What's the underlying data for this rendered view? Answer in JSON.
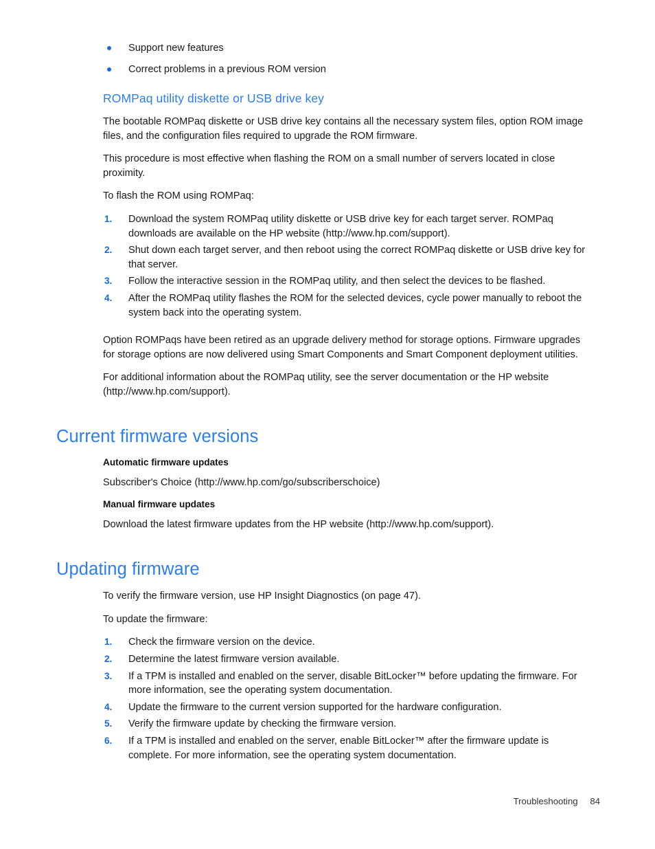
{
  "document": {
    "footer": {
      "chapter": "Troubleshooting",
      "page_number": "84"
    },
    "colors": {
      "heading_blue": "#2a7ef0",
      "marker_blue": "#1668dc",
      "body_text": "#1a1a1a"
    }
  },
  "intro_bullets": [
    "Support new features",
    "Correct problems in a previous ROM version"
  ],
  "rompaq_section": {
    "heading": "ROMPaq utility diskette or USB drive key",
    "paragraph_1": "The bootable ROMPaq diskette or USB drive key contains all the necessary system files, option ROM image files, and the configuration files required to upgrade the ROM firmware.",
    "paragraph_2": "This procedure is most effective when flashing the ROM on a small number of servers located in close proximity.",
    "lead_in": "To flash the ROM using ROMPaq:",
    "steps": [
      {
        "num": "1.",
        "text": "Download the system ROMPaq utility diskette or USB drive key for each target server. ROMPaq downloads are available on the HP website (http://www.hp.com/support)."
      },
      {
        "num": "2.",
        "text": "Shut down each target server, and then reboot using the correct ROMPaq diskette or USB drive key for that server."
      },
      {
        "num": "3.",
        "text": "Follow the interactive session in the ROMPaq utility, and then select the devices to be flashed."
      },
      {
        "num": "4.",
        "text": "After the ROMPaq utility flashes the ROM for the selected devices, cycle power manually to reboot the system back into the operating system."
      }
    ],
    "paragraph_3": "Option ROMPaqs have been retired as an upgrade delivery method for storage options. Firmware upgrades for storage options are now delivered using Smart Components and Smart Component deployment utilities.",
    "paragraph_4": "For additional information about the ROMPaq utility, see the server documentation or the HP website (http://www.hp.com/support)."
  },
  "current_firmware_section": {
    "heading": "Current firmware versions",
    "automatic_heading": "Automatic firmware updates",
    "automatic_text": "Subscriber's Choice (http://www.hp.com/go/subscriberschoice)",
    "manual_heading": "Manual firmware updates",
    "manual_text": "Download the latest firmware updates from the HP website (http://www.hp.com/support)."
  },
  "updating_firmware_section": {
    "heading": "Updating firmware",
    "paragraph_1": "To verify the firmware version, use HP Insight Diagnostics (on page 47).",
    "lead_in": "To update the firmware:",
    "steps": [
      {
        "num": "1.",
        "text": "Check the firmware version on the device."
      },
      {
        "num": "2.",
        "text": "Determine the latest firmware version available."
      },
      {
        "num": "3.",
        "text": "If a TPM is installed and enabled on the server, disable BitLocker™ before updating the firmware. For more information, see the operating system documentation."
      },
      {
        "num": "4.",
        "text": "Update the firmware to the current version supported for the hardware configuration."
      },
      {
        "num": "5.",
        "text": "Verify the firmware update by checking the firmware version."
      },
      {
        "num": "6.",
        "text": "If a TPM is installed and enabled on the server, enable BitLocker™ after the firmware update is complete. For more information, see the operating system documentation."
      }
    ]
  }
}
